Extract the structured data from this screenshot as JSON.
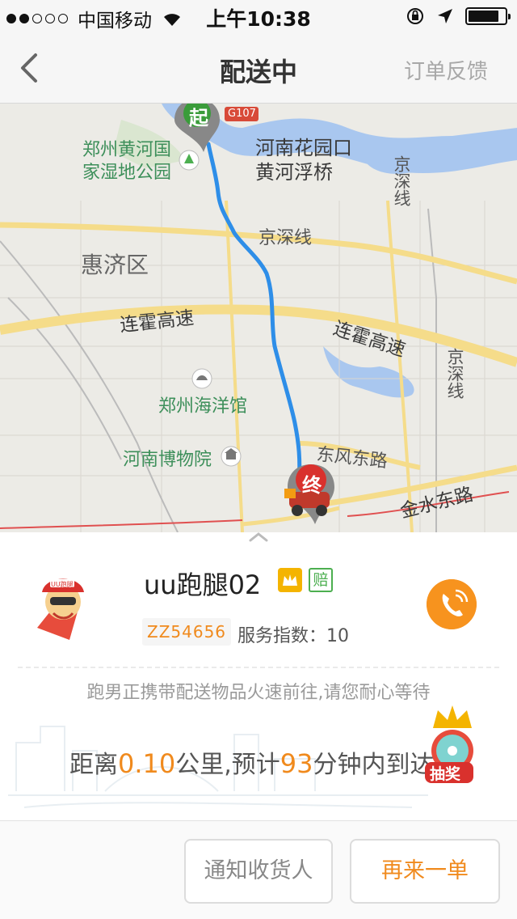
{
  "status_bar": {
    "carrier": "中国移动",
    "time": "上午10:38",
    "signal_filled": 2,
    "signal_total": 5,
    "battery_level": 0.85
  },
  "nav": {
    "title": "配送中",
    "feedback": "订单反馈",
    "back_icon": "chevron-left-icon"
  },
  "map": {
    "labels": {
      "wetland": "郑州黄河国\n家湿地公园",
      "bridge": "河南花园口\n黄河浮桥",
      "g107": "G107",
      "jingshen_1": "京深线",
      "jingshen_2": "京深线",
      "jingshen_3": "京深线",
      "huiji": "惠济区",
      "lianhuo_1": "连霍高速",
      "lianhuo_2": "连霍高速",
      "ocean": "郑州海洋馆",
      "museum": "河南博物院",
      "dongfeng": "东风东路",
      "jinshui": "金水东路"
    },
    "start_marker": "起",
    "end_marker": "终",
    "route_color": "#2e8ee8"
  },
  "courier": {
    "name": "uu跑腿02",
    "crown_icon": "crown-icon",
    "badge": "赔",
    "id": "ZZ54656",
    "score_label": "服务指数：10",
    "phone_icon": "phone-icon",
    "avatar_text": "UU跑腿"
  },
  "delivery": {
    "notice": "跑男正携带配送物品火速前往,请您耐心等待",
    "dist_prefix": "距离",
    "distance": "0.10",
    "dist_mid": "公里,预计",
    "minutes": "93",
    "dist_suffix": "分钟内到达",
    "lottery": "抽奖"
  },
  "footer": {
    "notify_label": "通知收货人",
    "again_label": "再来一单"
  },
  "colors": {
    "accent": "#f08a1d",
    "phone_bg": "#f7931e",
    "badge_green": "#4caf50",
    "route": "#2e8ee8"
  }
}
